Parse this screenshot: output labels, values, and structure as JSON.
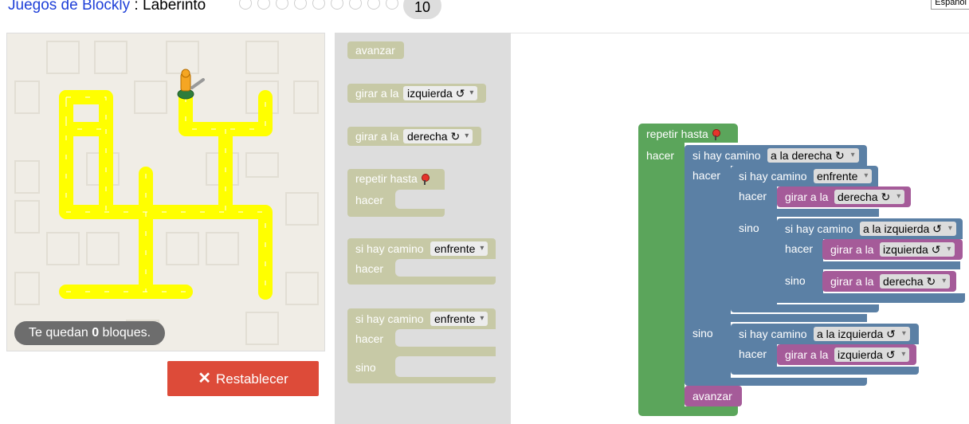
{
  "header": {
    "app_link": "Juegos de Blockly",
    "separator": " : ",
    "game": "Laberinto",
    "level_current": "10",
    "language": "Español"
  },
  "maze": {
    "remaining_prefix": "Te quedan ",
    "remaining_count": "0",
    "remaining_suffix": " bloques.",
    "reset_label": "Restablecer",
    "path_color": "#ffff00",
    "background_color": "#f0ede6"
  },
  "toolbox": {
    "advance": "avanzar",
    "turn_left_prefix": "girar a la",
    "turn_left_option": "izquierda ↺",
    "turn_right_prefix": "girar a la",
    "turn_right_option": "derecha ↻",
    "repeat_until": "repetir hasta",
    "do": "hacer",
    "if_path": "si hay camino",
    "if_path_option": "enfrente",
    "ifelse_path": "si hay camino",
    "ifelse_path_option": "enfrente",
    "ifelse_do": "hacer",
    "ifelse_else": "sino"
  },
  "program": {
    "repeat_until": "repetir hasta",
    "repeat_do": "hacer",
    "if1_label": "si hay camino",
    "if1_option": "a la derecha ↻",
    "if1_do": "hacer",
    "if2_label": "si hay camino",
    "if2_option": "enfrente",
    "if2_do": "hacer",
    "turn_a_prefix": "girar a la",
    "turn_a_option": "derecha ↻",
    "if2_else": "sino",
    "if3_label": "si hay camino",
    "if3_option": "a la izquierda ↺",
    "if3_do": "hacer",
    "turn_b_prefix": "girar a la",
    "turn_b_option": "izquierda ↺",
    "if3_else": "sino",
    "turn_c_prefix": "girar a la",
    "turn_c_option": "derecha ↻",
    "if1_else": "sino",
    "if4_label": "si hay camino",
    "if4_option": "a la izquierda ↺",
    "if4_do": "hacer",
    "turn_d_prefix": "girar a la",
    "turn_d_option": "izquierda ↺",
    "advance": "avanzar"
  },
  "colors": {
    "loop_block": "#5ba55b",
    "logic_block": "#5b80a5",
    "move_block": "#a55b99",
    "disabled_block": "#c7c9a6",
    "reset_button": "#dd4b39"
  }
}
